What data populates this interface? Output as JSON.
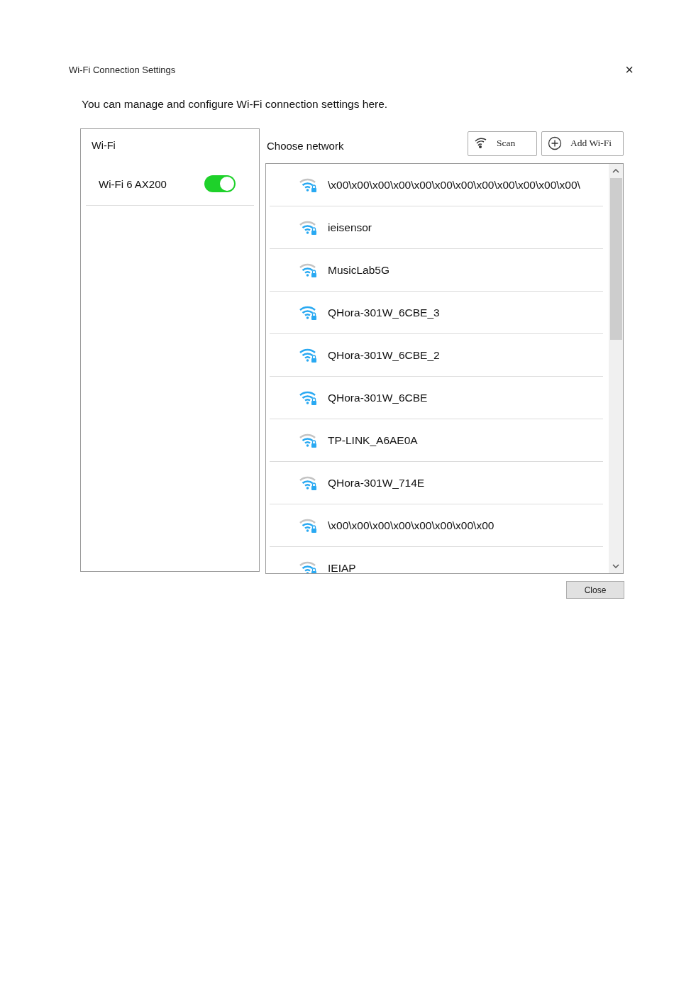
{
  "window": {
    "title": "Wi-Fi Connection Settings",
    "close": "×"
  },
  "description": "You can manage and configure Wi-Fi connection settings here.",
  "sidebar": {
    "title": "Wi-Fi",
    "adapters": [
      {
        "name": "Wi-Fi 6 AX200",
        "on": true
      }
    ]
  },
  "networks_header": {
    "title": "Choose network",
    "buttons": [
      {
        "kind": "scan",
        "label": "Scan"
      },
      {
        "kind": "add",
        "label": "Add Wi-Fi"
      }
    ]
  },
  "networks": [
    {
      "name": "\\x00\\x00\\x00\\x00\\x00\\x00\\x00\\x00\\x00\\x00\\x00\\x00\\",
      "strong_signal": false
    },
    {
      "name": "ieisensor",
      "strong_signal": false
    },
    {
      "name": "MusicLab5G",
      "strong_signal": false
    },
    {
      "name": "QHora-301W_6CBE_3",
      "strong_signal": true
    },
    {
      "name": "QHora-301W_6CBE_2",
      "strong_signal": true
    },
    {
      "name": "QHora-301W_6CBE",
      "strong_signal": true
    },
    {
      "name": "TP-LINK_A6AE0A",
      "strong_signal": false
    },
    {
      "name": "QHora-301W_714E",
      "strong_signal": false
    },
    {
      "name": "\\x00\\x00\\x00\\x00\\x00\\x00\\x00\\x00",
      "strong_signal": false
    },
    {
      "name": "IEIAP",
      "strong_signal": false
    }
  ],
  "footer": {
    "buttons": [
      "Close"
    ]
  }
}
